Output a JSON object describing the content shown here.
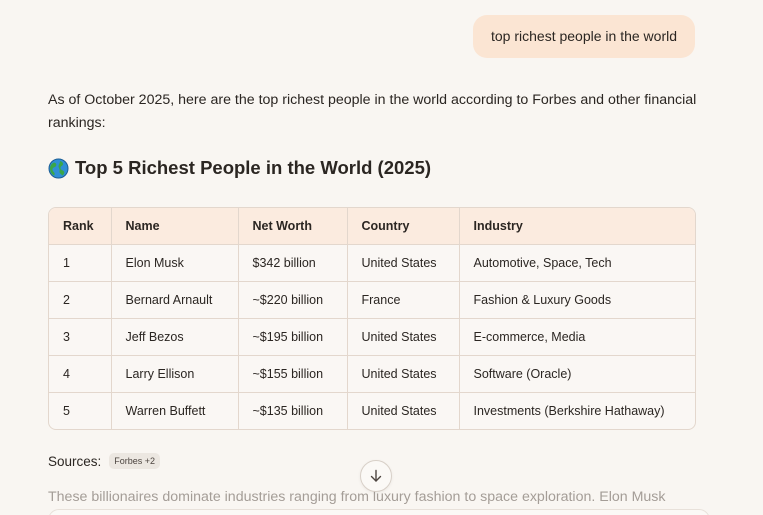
{
  "user_message": "top richest people in the world",
  "intro": "As of October 2025, here are the top richest people in the world according to Forbes and other financial rankings:",
  "heading": {
    "icon": "globe-icon",
    "text": "Top 5 Richest People in the World (2025)"
  },
  "table": {
    "headers": [
      "Rank",
      "Name",
      "Net Worth",
      "Country",
      "Industry"
    ],
    "rows": [
      [
        "1",
        "Elon Musk",
        "$342 billion",
        "United States",
        "Automotive, Space, Tech"
      ],
      [
        "2",
        "Bernard Arnault",
        "~$220 billion",
        "France",
        "Fashion & Luxury Goods"
      ],
      [
        "3",
        "Jeff Bezos",
        "~$195 billion",
        "United States",
        "E-commerce, Media"
      ],
      [
        "4",
        "Larry Ellison",
        "~$155 billion",
        "United States",
        "Software (Oracle)"
      ],
      [
        "5",
        "Warren Buffett",
        "~$135 billion",
        "United States",
        "Investments (Berkshire Hathaway)"
      ]
    ]
  },
  "sources": {
    "label": "Sources:",
    "badge": "Forbes +2"
  },
  "scroll_button_icon": "arrow-down-icon",
  "continuation_text": "These billionaires dominate industries ranging from luxury fashion to space exploration. Elon Musk",
  "colors": {
    "background": "#f9f6f2",
    "user_bubble": "#fbe5d3",
    "table_header": "#fbebdf",
    "border": "#e3d7cd"
  }
}
